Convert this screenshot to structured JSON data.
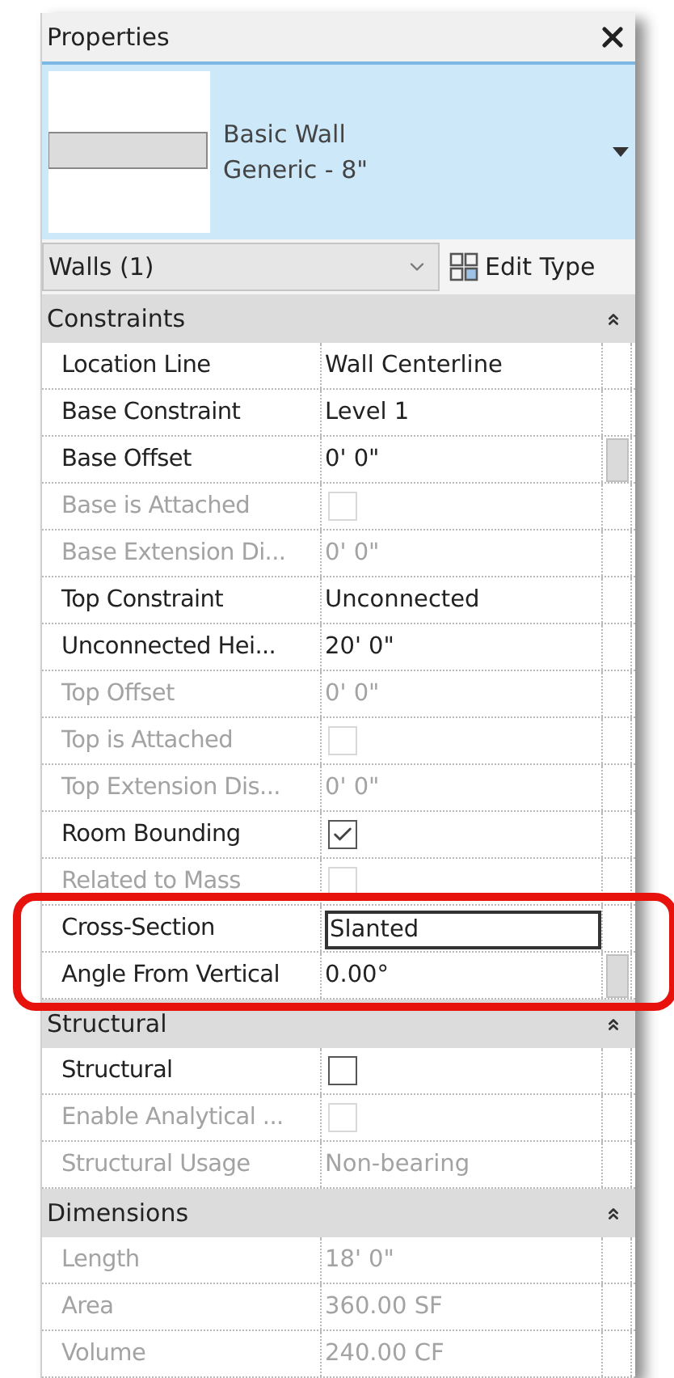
{
  "panel": {
    "title": "Properties",
    "closable": true
  },
  "type_selector": {
    "lines": [
      "Basic Wall",
      "Generic - 8\""
    ]
  },
  "instance_filter": {
    "value": "Walls (1)"
  },
  "edit_type": {
    "label": "Edit Type"
  },
  "sections": [
    {
      "title": "Constraints",
      "expanded": true,
      "rows": [
        {
          "label": "Location Line",
          "kind": "text",
          "value": "Wall Centerline",
          "disabled": false
        },
        {
          "label": "Base Constraint",
          "kind": "text",
          "value": "Level 1",
          "disabled": false
        },
        {
          "label": "Base Offset",
          "kind": "text",
          "value": "0'  0\"",
          "disabled": false,
          "scroll_thumb": true
        },
        {
          "label": "Base is Attached",
          "kind": "check",
          "checked": false,
          "disabled": true
        },
        {
          "label": "Base Extension Di...",
          "kind": "text",
          "value": "0'  0\"",
          "disabled": true
        },
        {
          "label": "Top Constraint",
          "kind": "text",
          "value": "Unconnected",
          "disabled": false
        },
        {
          "label": "Unconnected Hei...",
          "kind": "text",
          "value": "20'  0\"",
          "disabled": false
        },
        {
          "label": "Top Offset",
          "kind": "text",
          "value": "0'  0\"",
          "disabled": true
        },
        {
          "label": "Top is Attached",
          "kind": "check",
          "checked": false,
          "disabled": true
        },
        {
          "label": "Top Extension Dis...",
          "kind": "text",
          "value": "0'  0\"",
          "disabled": true
        },
        {
          "label": "Room Bounding",
          "kind": "check",
          "checked": true,
          "disabled": false
        },
        {
          "label": "Related to Mass",
          "kind": "check",
          "checked": false,
          "disabled": true
        },
        {
          "label": "Cross-Section",
          "kind": "field",
          "value": "Slanted",
          "disabled": false,
          "highlighted": true
        },
        {
          "label": "Angle From Vertical",
          "kind": "text",
          "value": "0.00°",
          "disabled": false,
          "highlighted": true,
          "scroll_thumb": true
        }
      ]
    },
    {
      "title": "Structural",
      "expanded": true,
      "rows": [
        {
          "label": "Structural",
          "kind": "check",
          "checked": false,
          "disabled": false
        },
        {
          "label": "Enable Analytical ...",
          "kind": "check",
          "checked": false,
          "disabled": true
        },
        {
          "label": "Structural Usage",
          "kind": "text",
          "value": "Non-bearing",
          "disabled": true
        }
      ]
    },
    {
      "title": "Dimensions",
      "expanded": true,
      "rows": [
        {
          "label": "Length",
          "kind": "text",
          "value": "18'  0\"",
          "disabled": true
        },
        {
          "label": "Area",
          "kind": "text",
          "value": "360.00 SF",
          "disabled": true
        },
        {
          "label": "Volume",
          "kind": "text",
          "value": "240.00 CF",
          "disabled": true
        }
      ]
    }
  ]
}
